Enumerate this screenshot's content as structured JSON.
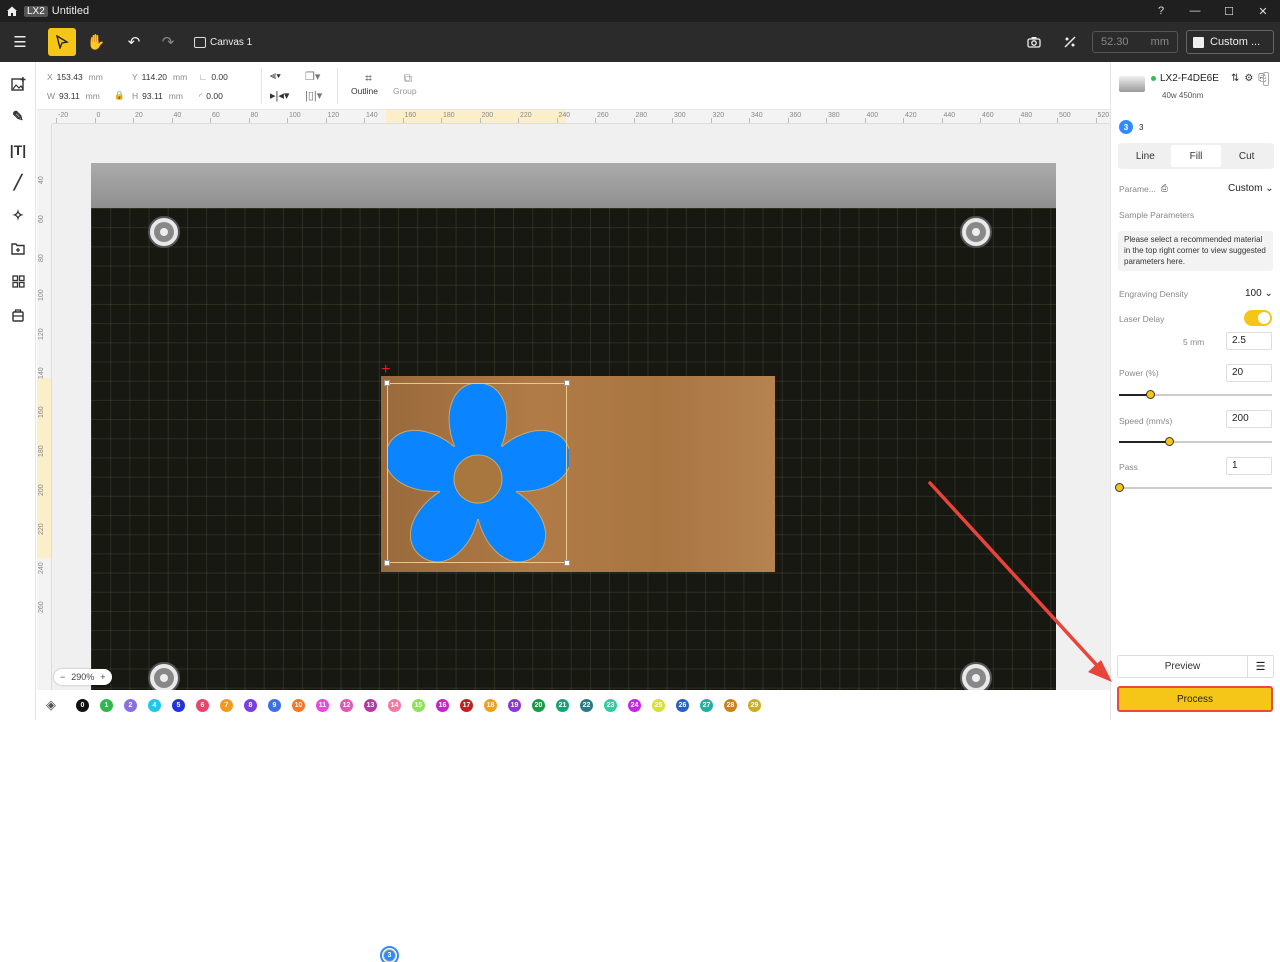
{
  "titlebar": {
    "badge": "LX2",
    "title": "Untitled",
    "win_buttons": [
      "?",
      "—",
      "☐",
      "✕"
    ]
  },
  "toolbar": {
    "canvas_tab": "Canvas 1",
    "focus_value": "52.30",
    "focus_unit": "mm",
    "material_label": "Custom ..."
  },
  "props": {
    "x_label": "X",
    "x_value": "153.43",
    "x_unit": "mm",
    "y_label": "Y",
    "y_value": "114.20",
    "y_unit": "mm",
    "angle_value": "0.00",
    "w_label": "W",
    "w_value": "93.11",
    "w_unit": "mm",
    "h_label": "H",
    "h_value": "93.11",
    "h_unit": "mm",
    "radius_value": "0.00",
    "outline_label": "Outline",
    "group_label": "Group"
  },
  "ruler": {
    "h_ticks": [
      "-20",
      "0",
      "20",
      "40",
      "60",
      "80",
      "100",
      "120",
      "140",
      "160",
      "180",
      "200",
      "220",
      "240",
      "260",
      "280",
      "300",
      "320",
      "340",
      "360",
      "380",
      "400",
      "420",
      "440",
      "460",
      "480",
      "500",
      "520"
    ],
    "v_ticks": [
      "40",
      "60",
      "80",
      "100",
      "120",
      "140",
      "160",
      "180",
      "200",
      "220",
      "240",
      "260"
    ]
  },
  "zoom": {
    "minus": "−",
    "value": "290%",
    "plus": "+"
  },
  "palette": [
    {
      "n": "0",
      "c": "#111111"
    },
    {
      "n": "1",
      "c": "#2fb84f"
    },
    {
      "n": "2",
      "c": "#8a6fe0"
    },
    {
      "n": "3",
      "c": "#2f8cff"
    },
    {
      "n": "4",
      "c": "#22c6e8"
    },
    {
      "n": "5",
      "c": "#2233dd"
    },
    {
      "n": "6",
      "c": "#e8456a"
    },
    {
      "n": "7",
      "c": "#f39a1c"
    },
    {
      "n": "8",
      "c": "#7a3fe0"
    },
    {
      "n": "9",
      "c": "#3f6fe0"
    },
    {
      "n": "10",
      "c": "#f07a2a"
    },
    {
      "n": "11",
      "c": "#e84ad8"
    },
    {
      "n": "12",
      "c": "#e05ab0"
    },
    {
      "n": "13",
      "c": "#b03aa0"
    },
    {
      "n": "14",
      "c": "#f07aa0"
    },
    {
      "n": "15",
      "c": "#8fe05a"
    },
    {
      "n": "16",
      "c": "#c02ac0"
    },
    {
      "n": "17",
      "c": "#c02020"
    },
    {
      "n": "18",
      "c": "#f0a020"
    },
    {
      "n": "19",
      "c": "#8a3ad0"
    },
    {
      "n": "20",
      "c": "#1a9a4a"
    },
    {
      "n": "21",
      "c": "#1aa07a"
    },
    {
      "n": "22",
      "c": "#2a7a8a"
    },
    {
      "n": "23",
      "c": "#2ad0a0"
    },
    {
      "n": "24",
      "c": "#c02ae0"
    },
    {
      "n": "25",
      "c": "#d8e030"
    },
    {
      "n": "26",
      "c": "#2a60c0"
    },
    {
      "n": "27",
      "c": "#20b0a0"
    },
    {
      "n": "28",
      "c": "#d0801a"
    },
    {
      "n": "29",
      "c": "#c8b020"
    }
  ],
  "device": {
    "name": "LX2-F4DE6E",
    "sub": "40w 450nm",
    "status_color": "#2cc14f"
  },
  "layer": {
    "number": "3",
    "label": "3"
  },
  "tabs": [
    "Line",
    "Fill",
    "Cut"
  ],
  "active_tab": "Fill",
  "params": {
    "param_label": "Parame...",
    "param_value": "Custom",
    "sample_title": "Sample Parameters",
    "sample_note": "Please select a recommended material in the top right corner to view suggested parameters here.",
    "density_label": "Engraving Density",
    "density_value": "100",
    "laser_delay_label": "Laser Delay",
    "laser_delay_on": true,
    "delay_unit": "5 mm",
    "delay_value": "2.5",
    "power_label": "Power  (%)",
    "power_value": "20",
    "power_fraction": 0.2,
    "speed_label": "Speed  (mm/s)",
    "speed_value": "200",
    "speed_fraction": 0.33,
    "pass_label": "Pass",
    "pass_value": "1",
    "pass_fraction": 0
  },
  "preview_label": "Preview",
  "process_label": "Process",
  "colors": {
    "accent": "#f5c518",
    "shape_fill": "#0a84ff",
    "highlight_border": "#e84a3d"
  }
}
